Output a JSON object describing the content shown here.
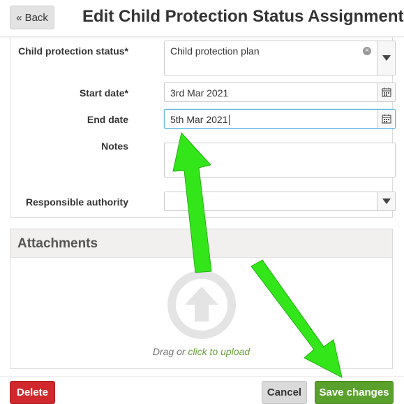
{
  "header": {
    "back_label": "« Back",
    "title": "Edit Child Protection Status Assignment"
  },
  "form": {
    "status": {
      "label": "Child protection status*",
      "value": "Child protection plan"
    },
    "start_date": {
      "label": "Start date*",
      "value": "3rd Mar 2021"
    },
    "end_date": {
      "label": "End date",
      "value": "5th Mar 2021"
    },
    "notes": {
      "label": "Notes",
      "value": ""
    },
    "responsible_authority": {
      "label": "Responsible authority",
      "value": ""
    }
  },
  "attachments": {
    "title": "Attachments",
    "drag_text": "Drag or",
    "upload_link": "click to upload"
  },
  "footer": {
    "delete_label": "Delete",
    "cancel_label": "Cancel",
    "save_label": "Save changes"
  },
  "icons": {
    "back": "back-button",
    "clear": "clear-icon",
    "dropdown": "caret-down-icon",
    "calendar": "calendar-icon",
    "upload": "upload-arrow-icon",
    "annotation": "green-arrow-icon"
  },
  "colors": {
    "delete": "#d0282c",
    "save": "#5aa02c",
    "link": "#6aa03c",
    "focus": "#5fb6e0",
    "annotation_arrow": "#33e61a"
  }
}
